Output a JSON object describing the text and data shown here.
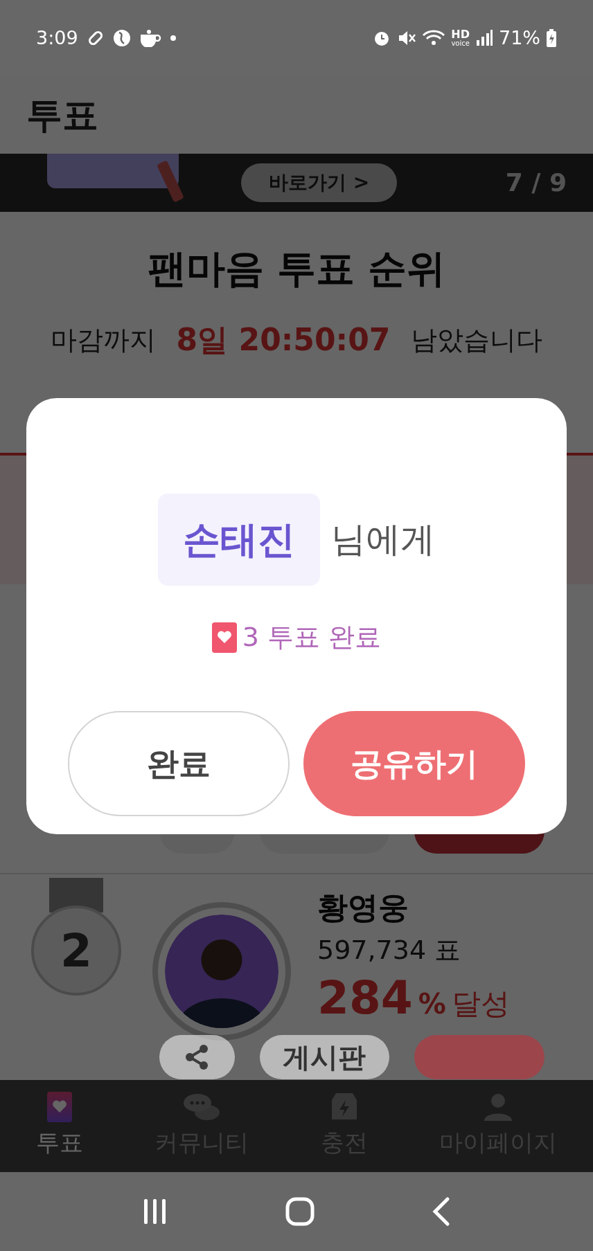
{
  "status_bar": {
    "time": "3:09",
    "hd_label": "HD",
    "voice_label": "voice",
    "battery": "71%"
  },
  "header": {
    "title": "투표"
  },
  "banner": {
    "button": "바로가기 >",
    "counter": "7 / 9"
  },
  "ranking": {
    "title": "팬마음 투표 순위",
    "countdown_prefix": "마감까지",
    "countdown_time": "8일 20:50:07",
    "countdown_suffix": "남았습니다"
  },
  "entries": [
    {
      "rank": "2",
      "name": "황영웅",
      "votes": "597,734 표",
      "percent": "284",
      "percent_sign": "%",
      "percent_suffix": "달성",
      "board_button": "게시판"
    }
  ],
  "dialog": {
    "recipient": "손태진",
    "recipient_suffix": "님에게",
    "result": "3 투표 완료",
    "buttons": [
      {
        "label": "완료",
        "kind": "secondary"
      },
      {
        "label": "공유하기",
        "kind": "primary"
      }
    ]
  },
  "tab_bar": [
    {
      "label": "투표",
      "kind": "vote",
      "selected": true
    },
    {
      "label": "커뮤니티",
      "kind": "community",
      "selected": false
    },
    {
      "label": "충전",
      "kind": "charge",
      "selected": false
    },
    {
      "label": "마이페이지",
      "kind": "mypage",
      "selected": false
    }
  ]
}
